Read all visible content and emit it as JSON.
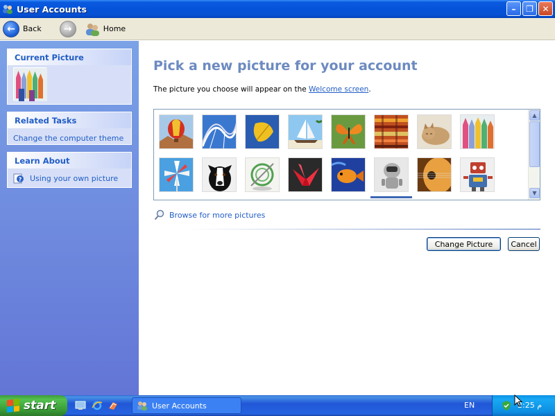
{
  "window": {
    "title": "User Accounts"
  },
  "toolbar": {
    "back_label": "Back",
    "home_label": "Home"
  },
  "sidebar": {
    "current_picture": {
      "title": "Current Picture"
    },
    "related_tasks": {
      "title": "Related Tasks",
      "items": [
        "Change the computer theme"
      ]
    },
    "learn_about": {
      "title": "Learn About",
      "items": [
        "Using your own picture"
      ]
    }
  },
  "main": {
    "heading": "Pick a new picture for your account",
    "subtext_prefix": "The picture you choose will appear on the ",
    "subtext_link": "Welcome screen",
    "subtext_suffix": ".",
    "pictures": [
      "hot-air-balloon",
      "roller-coaster",
      "yellow-leaf",
      "sailboat",
      "butterfly",
      "fabric",
      "kitten",
      "crayons",
      "pinwheel",
      "dog",
      "target-sculpture",
      "paper-crane",
      "fish",
      "robot-toy",
      "guitar",
      "robot"
    ],
    "browse_label": "Browse for more pictures",
    "change_button": "Change Picture",
    "cancel_button": "Cancel"
  },
  "taskbar": {
    "start_label": "start",
    "task_label": "User Accounts",
    "language": "EN",
    "clock": "2:25 م"
  }
}
